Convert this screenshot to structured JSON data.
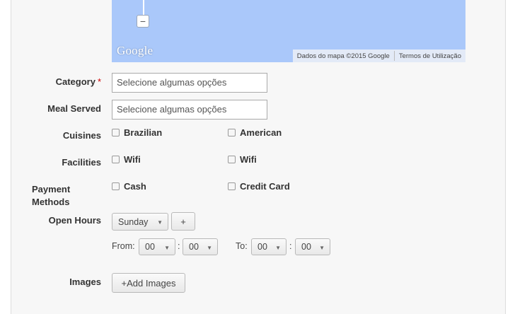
{
  "map": {
    "zoom_out_label": "−",
    "logo_text": "Google",
    "attribution": "Dados do mapa ©2015 Google",
    "terms": "Termos de Utilização"
  },
  "form": {
    "category_label": "Category",
    "required_mark": "*",
    "category_placeholder": "Selecione algumas opções",
    "meal_label": "Meal Served",
    "meal_placeholder": "Selecione algumas opções",
    "cuisines_label": "Cuisines",
    "cuisines": [
      "Brazilian",
      "American"
    ],
    "facilities_label": "Facilities",
    "facilities": [
      "Wifi",
      "Wifi"
    ],
    "payment_label_1": "Payment",
    "payment_label_2": "Methods",
    "payments": [
      "Cash",
      "Credit Card"
    ],
    "open_hours_label": "Open Hours",
    "day_value": "Sunday",
    "add_hours": "+",
    "from_label": "From:",
    "from_hour": "00",
    "from_min": "00",
    "time_sep": ":",
    "to_label": "To:",
    "to_hour": "00",
    "to_min": "00",
    "images_label": "Images",
    "add_images": "+Add Images"
  },
  "icons": {
    "dropdown": "caret-down-icon"
  }
}
